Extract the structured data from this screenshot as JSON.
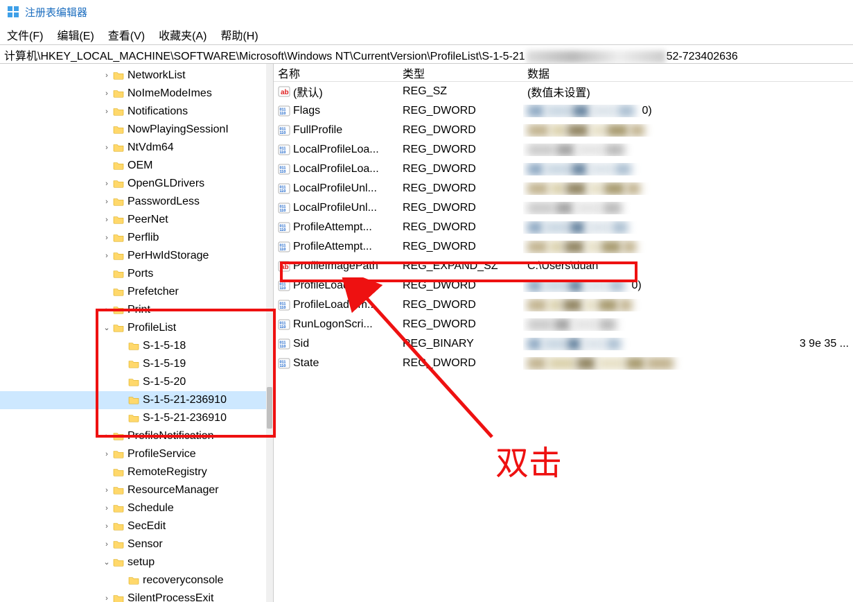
{
  "window": {
    "title": "注册表编辑器"
  },
  "menu": {
    "file": "文件(F)",
    "edit": "编辑(E)",
    "view": "查看(V)",
    "favorites": "收藏夹(A)",
    "help": "帮助(H)"
  },
  "address": {
    "prefix": "计算机\\HKEY_LOCAL_MACHINE\\SOFTWARE\\Microsoft\\Windows NT\\CurrentVersion\\ProfileList\\S-1-5-21",
    "suffix": "52-723402636"
  },
  "tree": {
    "items": [
      {
        "label": "NetworkList",
        "expander": ">",
        "depth": 3
      },
      {
        "label": "NoImeModeImes",
        "expander": ">",
        "depth": 3
      },
      {
        "label": "Notifications",
        "expander": ">",
        "depth": 3
      },
      {
        "label": "NowPlayingSessionI",
        "expander": "",
        "depth": 3
      },
      {
        "label": "NtVdm64",
        "expander": ">",
        "depth": 3
      },
      {
        "label": "OEM",
        "expander": "",
        "depth": 3
      },
      {
        "label": "OpenGLDrivers",
        "expander": ">",
        "depth": 3
      },
      {
        "label": "PasswordLess",
        "expander": ">",
        "depth": 3
      },
      {
        "label": "PeerNet",
        "expander": ">",
        "depth": 3
      },
      {
        "label": "Perflib",
        "expander": ">",
        "depth": 3
      },
      {
        "label": "PerHwIdStorage",
        "expander": ">",
        "depth": 3
      },
      {
        "label": "Ports",
        "expander": "",
        "depth": 3
      },
      {
        "label": "Prefetcher",
        "expander": "",
        "depth": 3
      },
      {
        "label": "Print",
        "expander": ">",
        "depth": 3
      },
      {
        "label": "ProfileList",
        "expander": "v",
        "depth": 3
      },
      {
        "label": "S-1-5-18",
        "expander": "",
        "depth": 4
      },
      {
        "label": "S-1-5-19",
        "expander": "",
        "depth": 4
      },
      {
        "label": "S-1-5-20",
        "expander": "",
        "depth": 4
      },
      {
        "label": "S-1-5-21-236910",
        "expander": "",
        "depth": 4,
        "selected": true
      },
      {
        "label": "S-1-5-21-236910",
        "expander": "",
        "depth": 4
      },
      {
        "label": "ProfileNotification",
        "expander": ">",
        "depth": 3
      },
      {
        "label": "ProfileService",
        "expander": ">",
        "depth": 3
      },
      {
        "label": "RemoteRegistry",
        "expander": "",
        "depth": 3
      },
      {
        "label": "ResourceManager",
        "expander": ">",
        "depth": 3
      },
      {
        "label": "Schedule",
        "expander": ">",
        "depth": 3
      },
      {
        "label": "SecEdit",
        "expander": ">",
        "depth": 3
      },
      {
        "label": "Sensor",
        "expander": ">",
        "depth": 3
      },
      {
        "label": "setup",
        "expander": "v",
        "depth": 3
      },
      {
        "label": "recoveryconsole",
        "expander": "",
        "depth": 4
      },
      {
        "label": "SilentProcessExit",
        "expander": ">",
        "depth": 3
      }
    ]
  },
  "list": {
    "headers": {
      "name": "名称",
      "type": "类型",
      "data": "数据"
    },
    "rows": [
      {
        "icon": "sz",
        "name": "(默认)",
        "type": "REG_SZ",
        "data": "(数值未设置)",
        "blurData": false
      },
      {
        "icon": "dw",
        "name": "Flags",
        "type": "REG_DWORD",
        "data": "",
        "blurData": true,
        "trail": "0)"
      },
      {
        "icon": "dw",
        "name": "FullProfile",
        "type": "REG_DWORD",
        "data": "",
        "blurData": true
      },
      {
        "icon": "dw",
        "name": "LocalProfileLoa...",
        "type": "REG_DWORD",
        "data": "",
        "blurData": true
      },
      {
        "icon": "dw",
        "name": "LocalProfileLoa...",
        "type": "REG_DWORD",
        "data": "",
        "blurData": true
      },
      {
        "icon": "dw",
        "name": "LocalProfileUnl...",
        "type": "REG_DWORD",
        "data": "",
        "blurData": true
      },
      {
        "icon": "dw",
        "name": "LocalProfileUnl...",
        "type": "REG_DWORD",
        "data": "",
        "blurData": true
      },
      {
        "icon": "dw",
        "name": "ProfileAttempt...",
        "type": "REG_DWORD",
        "data": "",
        "blurData": true
      },
      {
        "icon": "dw",
        "name": "ProfileAttempt...",
        "type": "REG_DWORD",
        "data": "",
        "blurData": true
      },
      {
        "icon": "sz",
        "name": "ProfileImagePath",
        "type": "REG_EXPAND_SZ",
        "data": "C:\\Users\\duan",
        "blurData": false
      },
      {
        "icon": "dw",
        "name": "ProfileLoadTim...",
        "type": "REG_DWORD",
        "data": "",
        "blurData": true,
        "trail": "0)"
      },
      {
        "icon": "dw",
        "name": "ProfileLoadTim...",
        "type": "REG_DWORD",
        "data": "",
        "blurData": true
      },
      {
        "icon": "dw",
        "name": "RunLogonScri...",
        "type": "REG_DWORD",
        "data": "",
        "blurData": true
      },
      {
        "icon": "dw",
        "name": "Sid",
        "type": "REG_BINARY",
        "data": "",
        "blurData": true,
        "tail": "3 9e 35 ..."
      },
      {
        "icon": "dw",
        "name": "State",
        "type": "REG_DWORD",
        "data": "",
        "blurData": true
      }
    ]
  },
  "annotation": {
    "label": "双击"
  }
}
